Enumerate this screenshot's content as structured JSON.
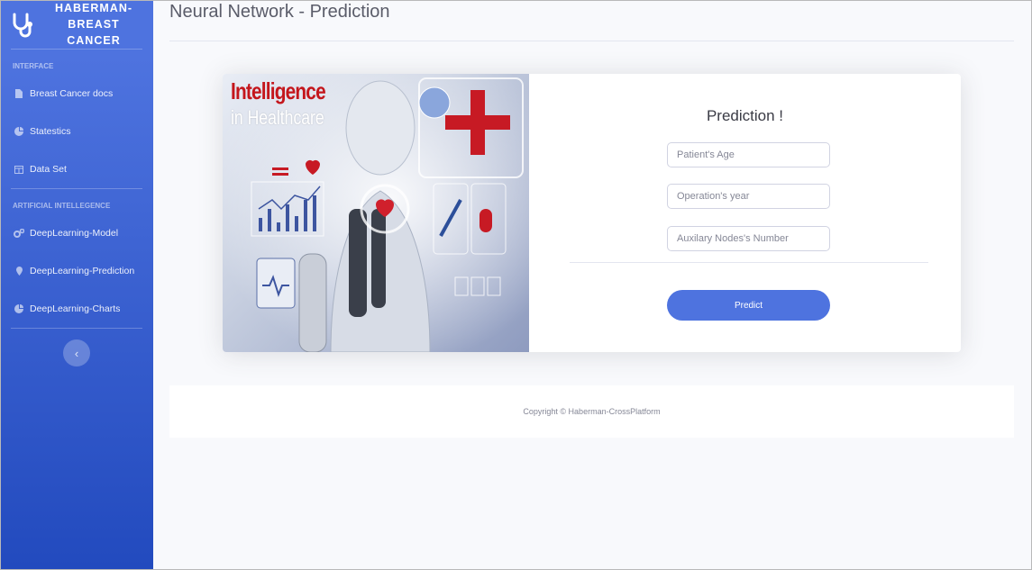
{
  "brand": {
    "line1": "HABERMAN-",
    "line2": "BREAST CANCER",
    "icon": "stethoscope-icon"
  },
  "sidebar": {
    "heading_interface": "INTERFACE",
    "heading_ai": "ARTIFICIAL INTELLEGENCE",
    "items": [
      {
        "label": "Breast Cancer docs",
        "icon": "file-icon"
      },
      {
        "label": "Statestics",
        "icon": "chart-pie-icon"
      },
      {
        "label": "Data Set",
        "icon": "table-icon"
      },
      {
        "label": "DeepLearning-Model",
        "icon": "cogs-icon"
      },
      {
        "label": "DeepLearning-Prediction",
        "icon": "map-marker-icon"
      },
      {
        "label": "DeepLearning-Charts",
        "icon": "chart-pie-icon"
      }
    ],
    "toggle_glyph": "‹"
  },
  "page": {
    "title": "Neural Network - Prediction"
  },
  "hero": {
    "title": "Intelligence",
    "subtitle": "in Healthcare"
  },
  "form": {
    "title": "Prediction !",
    "age_placeholder": "Patient's Age",
    "year_placeholder": "Operation's year",
    "nodes_placeholder": "Auxilary Nodes's Number",
    "submit_label": "Predict"
  },
  "footer": {
    "copyright": "Copyright © Haberman-CrossPlatform"
  },
  "colors": {
    "primary": "#4e73df",
    "sidebar_end": "#224abe",
    "hero_red": "#c4161c"
  }
}
